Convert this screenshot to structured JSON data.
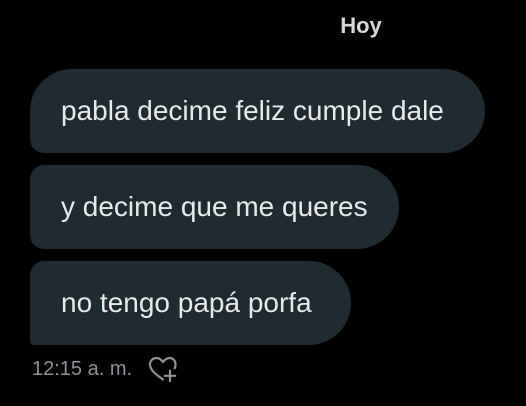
{
  "conversation": {
    "day_separator": "Hoy",
    "messages": [
      {
        "text": "pabla decime feliz cumple dale"
      },
      {
        "text": "y decime que me queres"
      },
      {
        "text": "no tengo papá porfa"
      }
    ],
    "timestamp": "12:15 a. m.",
    "reaction_icon": "heart-plus-icon"
  },
  "colors": {
    "background": "#000000",
    "bubble": "#202a31",
    "bubble_text": "#e7e9ea",
    "meta_text": "#8b9298"
  }
}
